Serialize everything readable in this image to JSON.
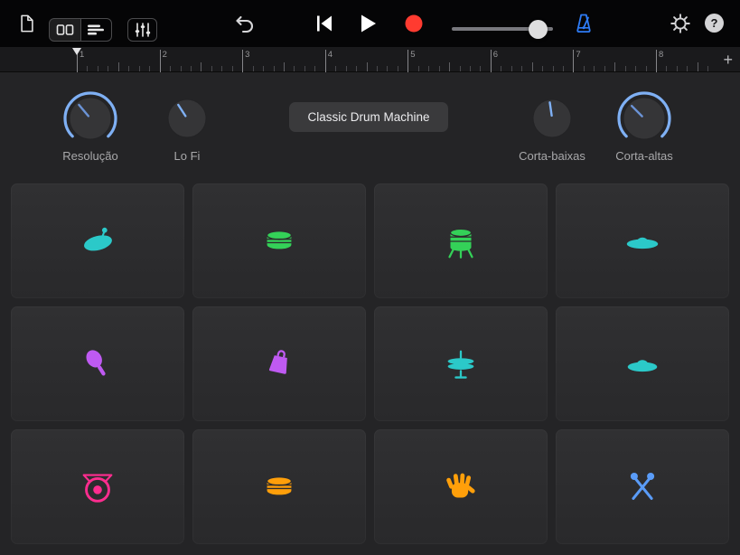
{
  "toolbar": {
    "help_label": "?",
    "volume": 0.85,
    "icons": [
      "document-icon",
      "pads-view-icon",
      "tracks-view-icon",
      "mixer-icon",
      "undo-icon",
      "skip-to-start-icon",
      "play-icon",
      "record-icon",
      "volume-slider",
      "metronome-icon",
      "settings-gear-icon",
      "help-icon"
    ]
  },
  "ruler": {
    "beats": [
      "1",
      "2",
      "3",
      "4",
      "5",
      "6",
      "7",
      "8"
    ],
    "add_label": "+"
  },
  "controls": {
    "preset_label": "Classic Drum Machine",
    "knobs": [
      {
        "id": "resolucao",
        "label": "Resolução",
        "type": "arc",
        "angle": -40
      },
      {
        "id": "lo-fi",
        "label": "Lo Fi",
        "type": "plain",
        "angle": -33
      },
      {
        "id": "corta-baixas",
        "label": "Corta-baixas",
        "type": "plain",
        "angle": -8
      },
      {
        "id": "corta-altas",
        "label": "Corta-altas",
        "type": "arc",
        "angle": -45
      }
    ]
  },
  "pads": [
    {
      "id": "kick-drum",
      "icon": "kick",
      "color": "#2bc9c9"
    },
    {
      "id": "snare-drum",
      "icon": "snare",
      "color": "#34d158"
    },
    {
      "id": "floor-tom",
      "icon": "floortom",
      "color": "#34d158"
    },
    {
      "id": "ride-cymbal",
      "icon": "cymbal",
      "color": "#2bc9c9"
    },
    {
      "id": "shaker",
      "icon": "shaker",
      "color": "#bf5af2"
    },
    {
      "id": "cowbell",
      "icon": "cowbell",
      "color": "#bf5af2"
    },
    {
      "id": "hi-hat",
      "icon": "hihat",
      "color": "#2bc9c9"
    },
    {
      "id": "open-cymbal",
      "icon": "cymbalbell",
      "color": "#2bc9c9"
    },
    {
      "id": "gong",
      "icon": "gong",
      "color": "#ff2d8f"
    },
    {
      "id": "snare-2",
      "icon": "snare",
      "color": "#ff9f0a"
    },
    {
      "id": "clap",
      "icon": "clap",
      "color": "#ff9f0a"
    },
    {
      "id": "sticks",
      "icon": "sticks",
      "color": "#5a9cf8"
    }
  ],
  "colors": {
    "accent_blue": "#2e7cf6",
    "record_red": "#ff3b30",
    "knob_arc": "#7fb0f4",
    "pad_background": "#2c2c2e"
  }
}
